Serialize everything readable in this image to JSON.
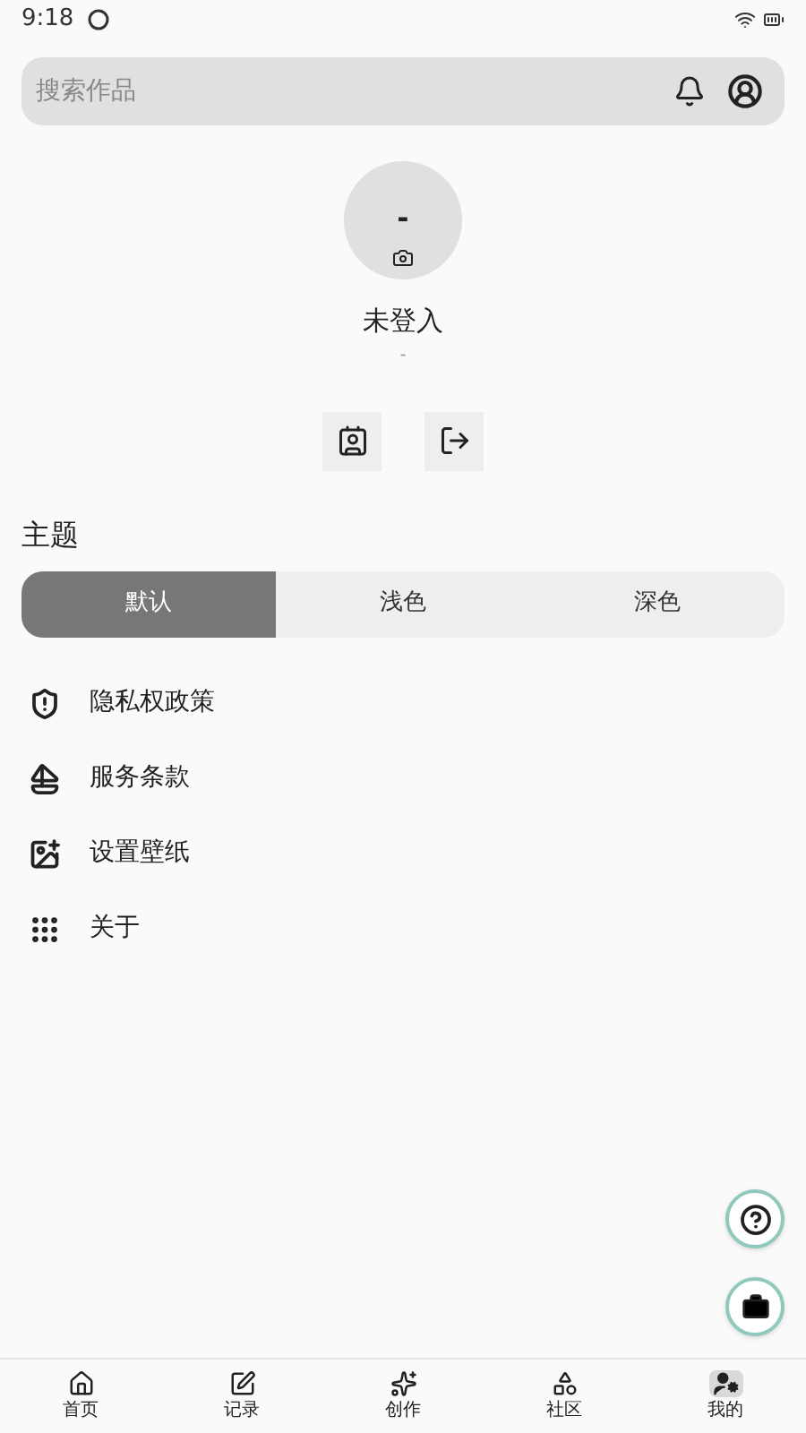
{
  "status_bar": {
    "time": "9:18"
  },
  "search": {
    "placeholder": "搜索作品"
  },
  "profile": {
    "avatar_text": "-",
    "name": "未登入",
    "subtitle": "-"
  },
  "theme": {
    "title": "主题",
    "options": [
      {
        "label": "默认",
        "selected": true
      },
      {
        "label": "浅色",
        "selected": false
      },
      {
        "label": "深色",
        "selected": false
      }
    ]
  },
  "menu": [
    {
      "kind": "privacy",
      "label": "隐私权政策"
    },
    {
      "kind": "terms",
      "label": "服务条款"
    },
    {
      "kind": "wallpaper",
      "label": "设置壁纸"
    },
    {
      "kind": "about",
      "label": "关于"
    }
  ],
  "nav": [
    {
      "kind": "home",
      "label": "首页",
      "selected": false
    },
    {
      "kind": "record",
      "label": "记录",
      "selected": false
    },
    {
      "kind": "create",
      "label": "创作",
      "selected": false
    },
    {
      "kind": "community",
      "label": "社区",
      "selected": false
    },
    {
      "kind": "mine",
      "label": "我的",
      "selected": true
    }
  ]
}
